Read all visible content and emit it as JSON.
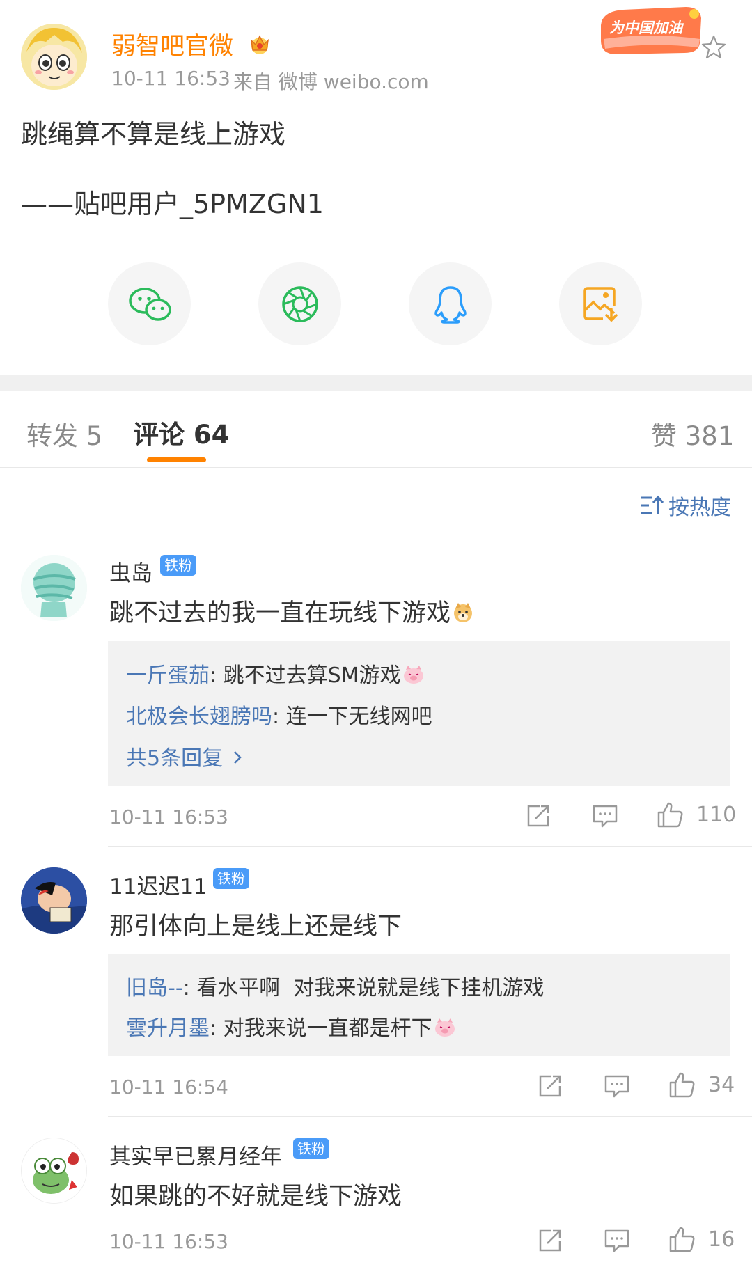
{
  "post": {
    "author": "弱智吧官微",
    "time": "10-11 16:53",
    "source": "来自 微博 weibo.com",
    "text_line1": "跳绳算不算是线上游戏",
    "text_line2": "——贴吧用户_5PMZGN1",
    "banner_text": "为中国加油"
  },
  "share": {
    "items": [
      "wechat-icon",
      "moments-icon",
      "qq-icon",
      "save-image-icon"
    ],
    "colors": {
      "wechat": "#2bbb5b",
      "moments": "#2bbb5b",
      "qq": "#2b9dfb",
      "save": "#f5a623"
    }
  },
  "tabs": {
    "repost": "转发 5",
    "comments": "评论 64",
    "likes": "赞 381",
    "accent": "#ff8200"
  },
  "sort": {
    "label": "按热度"
  },
  "comments": [
    {
      "name": "虫岛",
      "badge": "铁粉",
      "text": "跳不过去的我一直在玩线下游戏",
      "replies": [
        {
          "name": "一斤蛋茄",
          "text": ": 跳不过去算SM游戏"
        },
        {
          "name": "北极会长翅膀吗",
          "text": ": 连一下无线网吧"
        }
      ],
      "more": "共5条回复",
      "time": "10-11 16:53",
      "likes": "110"
    },
    {
      "name": "11迟迟11",
      "badge": "铁粉",
      "text": "那引体向上是线上还是线下",
      "replies": [
        {
          "name": "旧岛--",
          "text": ": 看水平啊  对我来说就是线下挂机游戏"
        },
        {
          "name": "雲升月墨",
          "text": ": 对我来说一直都是杆下"
        }
      ],
      "time": "10-11 16:54",
      "likes": "34"
    },
    {
      "name": "其实早已累月经年",
      "badge": "铁粉",
      "text": "如果跳的不好就是线下游戏",
      "time": "10-11 16:53",
      "likes": "16"
    }
  ]
}
